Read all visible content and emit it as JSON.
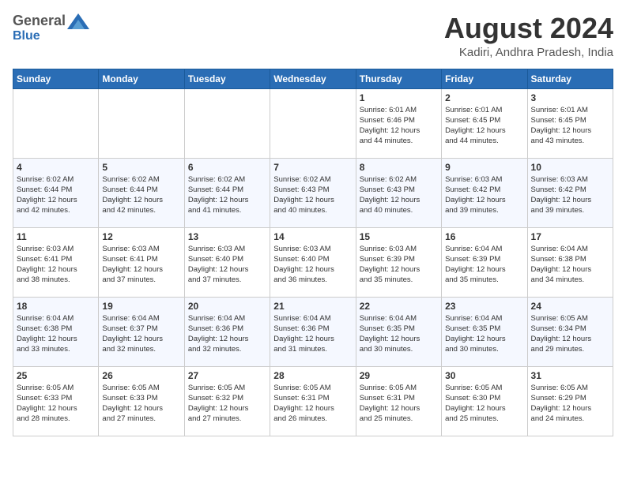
{
  "header": {
    "logo_general": "General",
    "logo_blue": "Blue",
    "month_title": "August 2024",
    "location": "Kadiri, Andhra Pradesh, India"
  },
  "weekdays": [
    "Sunday",
    "Monday",
    "Tuesday",
    "Wednesday",
    "Thursday",
    "Friday",
    "Saturday"
  ],
  "weeks": [
    [
      {
        "day": "",
        "info": ""
      },
      {
        "day": "",
        "info": ""
      },
      {
        "day": "",
        "info": ""
      },
      {
        "day": "",
        "info": ""
      },
      {
        "day": "1",
        "info": "Sunrise: 6:01 AM\nSunset: 6:46 PM\nDaylight: 12 hours\nand 44 minutes."
      },
      {
        "day": "2",
        "info": "Sunrise: 6:01 AM\nSunset: 6:45 PM\nDaylight: 12 hours\nand 44 minutes."
      },
      {
        "day": "3",
        "info": "Sunrise: 6:01 AM\nSunset: 6:45 PM\nDaylight: 12 hours\nand 43 minutes."
      }
    ],
    [
      {
        "day": "4",
        "info": "Sunrise: 6:02 AM\nSunset: 6:44 PM\nDaylight: 12 hours\nand 42 minutes."
      },
      {
        "day": "5",
        "info": "Sunrise: 6:02 AM\nSunset: 6:44 PM\nDaylight: 12 hours\nand 42 minutes."
      },
      {
        "day": "6",
        "info": "Sunrise: 6:02 AM\nSunset: 6:44 PM\nDaylight: 12 hours\nand 41 minutes."
      },
      {
        "day": "7",
        "info": "Sunrise: 6:02 AM\nSunset: 6:43 PM\nDaylight: 12 hours\nand 40 minutes."
      },
      {
        "day": "8",
        "info": "Sunrise: 6:02 AM\nSunset: 6:43 PM\nDaylight: 12 hours\nand 40 minutes."
      },
      {
        "day": "9",
        "info": "Sunrise: 6:03 AM\nSunset: 6:42 PM\nDaylight: 12 hours\nand 39 minutes."
      },
      {
        "day": "10",
        "info": "Sunrise: 6:03 AM\nSunset: 6:42 PM\nDaylight: 12 hours\nand 39 minutes."
      }
    ],
    [
      {
        "day": "11",
        "info": "Sunrise: 6:03 AM\nSunset: 6:41 PM\nDaylight: 12 hours\nand 38 minutes."
      },
      {
        "day": "12",
        "info": "Sunrise: 6:03 AM\nSunset: 6:41 PM\nDaylight: 12 hours\nand 37 minutes."
      },
      {
        "day": "13",
        "info": "Sunrise: 6:03 AM\nSunset: 6:40 PM\nDaylight: 12 hours\nand 37 minutes."
      },
      {
        "day": "14",
        "info": "Sunrise: 6:03 AM\nSunset: 6:40 PM\nDaylight: 12 hours\nand 36 minutes."
      },
      {
        "day": "15",
        "info": "Sunrise: 6:03 AM\nSunset: 6:39 PM\nDaylight: 12 hours\nand 35 minutes."
      },
      {
        "day": "16",
        "info": "Sunrise: 6:04 AM\nSunset: 6:39 PM\nDaylight: 12 hours\nand 35 minutes."
      },
      {
        "day": "17",
        "info": "Sunrise: 6:04 AM\nSunset: 6:38 PM\nDaylight: 12 hours\nand 34 minutes."
      }
    ],
    [
      {
        "day": "18",
        "info": "Sunrise: 6:04 AM\nSunset: 6:38 PM\nDaylight: 12 hours\nand 33 minutes."
      },
      {
        "day": "19",
        "info": "Sunrise: 6:04 AM\nSunset: 6:37 PM\nDaylight: 12 hours\nand 32 minutes."
      },
      {
        "day": "20",
        "info": "Sunrise: 6:04 AM\nSunset: 6:36 PM\nDaylight: 12 hours\nand 32 minutes."
      },
      {
        "day": "21",
        "info": "Sunrise: 6:04 AM\nSunset: 6:36 PM\nDaylight: 12 hours\nand 31 minutes."
      },
      {
        "day": "22",
        "info": "Sunrise: 6:04 AM\nSunset: 6:35 PM\nDaylight: 12 hours\nand 30 minutes."
      },
      {
        "day": "23",
        "info": "Sunrise: 6:04 AM\nSunset: 6:35 PM\nDaylight: 12 hours\nand 30 minutes."
      },
      {
        "day": "24",
        "info": "Sunrise: 6:05 AM\nSunset: 6:34 PM\nDaylight: 12 hours\nand 29 minutes."
      }
    ],
    [
      {
        "day": "25",
        "info": "Sunrise: 6:05 AM\nSunset: 6:33 PM\nDaylight: 12 hours\nand 28 minutes."
      },
      {
        "day": "26",
        "info": "Sunrise: 6:05 AM\nSunset: 6:33 PM\nDaylight: 12 hours\nand 27 minutes."
      },
      {
        "day": "27",
        "info": "Sunrise: 6:05 AM\nSunset: 6:32 PM\nDaylight: 12 hours\nand 27 minutes."
      },
      {
        "day": "28",
        "info": "Sunrise: 6:05 AM\nSunset: 6:31 PM\nDaylight: 12 hours\nand 26 minutes."
      },
      {
        "day": "29",
        "info": "Sunrise: 6:05 AM\nSunset: 6:31 PM\nDaylight: 12 hours\nand 25 minutes."
      },
      {
        "day": "30",
        "info": "Sunrise: 6:05 AM\nSunset: 6:30 PM\nDaylight: 12 hours\nand 25 minutes."
      },
      {
        "day": "31",
        "info": "Sunrise: 6:05 AM\nSunset: 6:29 PM\nDaylight: 12 hours\nand 24 minutes."
      }
    ]
  ]
}
